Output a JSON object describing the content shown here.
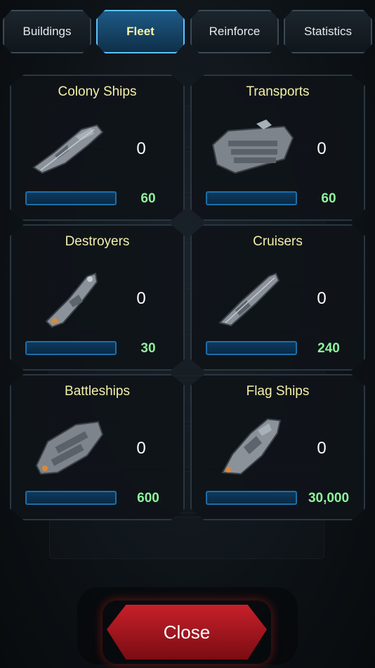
{
  "tabs": [
    {
      "label": "Buildings",
      "active": false
    },
    {
      "label": "Fleet",
      "active": true
    },
    {
      "label": "Reinforce",
      "active": false
    },
    {
      "label": "Statistics",
      "active": false
    }
  ],
  "cards": [
    {
      "title": "Colony Ships",
      "count": "0",
      "cost": "60",
      "progress": 0
    },
    {
      "title": "Transports",
      "count": "0",
      "cost": "60",
      "progress": 0
    },
    {
      "title": "Destroyers",
      "count": "0",
      "cost": "30",
      "progress": 0
    },
    {
      "title": "Cruisers",
      "count": "0",
      "cost": "240",
      "progress": 0
    },
    {
      "title": "Battleships",
      "count": "0",
      "cost": "600",
      "progress": 0
    },
    {
      "title": "Flag Ships",
      "count": "0",
      "cost": "30,000",
      "progress": 0
    }
  ],
  "close_label": "Close",
  "colors": {
    "accent": "#5cc2ff",
    "title_yellow": "#f4f0a8",
    "cost_green": "#8ef59a",
    "close_red": "#c8202a"
  }
}
